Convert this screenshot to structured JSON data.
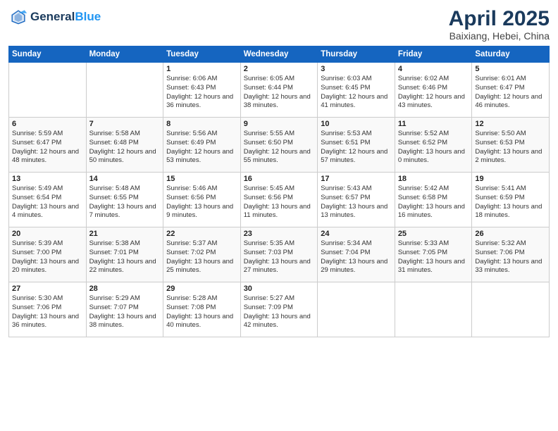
{
  "header": {
    "logo_line1": "General",
    "logo_line2": "Blue",
    "title": "April 2025",
    "subtitle": "Baixiang, Hebei, China"
  },
  "days_of_week": [
    "Sunday",
    "Monday",
    "Tuesday",
    "Wednesday",
    "Thursday",
    "Friday",
    "Saturday"
  ],
  "weeks": [
    [
      {
        "day": "",
        "sunrise": "",
        "sunset": "",
        "daylight": ""
      },
      {
        "day": "",
        "sunrise": "",
        "sunset": "",
        "daylight": ""
      },
      {
        "day": "1",
        "sunrise": "Sunrise: 6:06 AM",
        "sunset": "Sunset: 6:43 PM",
        "daylight": "Daylight: 12 hours and 36 minutes."
      },
      {
        "day": "2",
        "sunrise": "Sunrise: 6:05 AM",
        "sunset": "Sunset: 6:44 PM",
        "daylight": "Daylight: 12 hours and 38 minutes."
      },
      {
        "day": "3",
        "sunrise": "Sunrise: 6:03 AM",
        "sunset": "Sunset: 6:45 PM",
        "daylight": "Daylight: 12 hours and 41 minutes."
      },
      {
        "day": "4",
        "sunrise": "Sunrise: 6:02 AM",
        "sunset": "Sunset: 6:46 PM",
        "daylight": "Daylight: 12 hours and 43 minutes."
      },
      {
        "day": "5",
        "sunrise": "Sunrise: 6:01 AM",
        "sunset": "Sunset: 6:47 PM",
        "daylight": "Daylight: 12 hours and 46 minutes."
      }
    ],
    [
      {
        "day": "6",
        "sunrise": "Sunrise: 5:59 AM",
        "sunset": "Sunset: 6:47 PM",
        "daylight": "Daylight: 12 hours and 48 minutes."
      },
      {
        "day": "7",
        "sunrise": "Sunrise: 5:58 AM",
        "sunset": "Sunset: 6:48 PM",
        "daylight": "Daylight: 12 hours and 50 minutes."
      },
      {
        "day": "8",
        "sunrise": "Sunrise: 5:56 AM",
        "sunset": "Sunset: 6:49 PM",
        "daylight": "Daylight: 12 hours and 53 minutes."
      },
      {
        "day": "9",
        "sunrise": "Sunrise: 5:55 AM",
        "sunset": "Sunset: 6:50 PM",
        "daylight": "Daylight: 12 hours and 55 minutes."
      },
      {
        "day": "10",
        "sunrise": "Sunrise: 5:53 AM",
        "sunset": "Sunset: 6:51 PM",
        "daylight": "Daylight: 12 hours and 57 minutes."
      },
      {
        "day": "11",
        "sunrise": "Sunrise: 5:52 AM",
        "sunset": "Sunset: 6:52 PM",
        "daylight": "Daylight: 13 hours and 0 minutes."
      },
      {
        "day": "12",
        "sunrise": "Sunrise: 5:50 AM",
        "sunset": "Sunset: 6:53 PM",
        "daylight": "Daylight: 13 hours and 2 minutes."
      }
    ],
    [
      {
        "day": "13",
        "sunrise": "Sunrise: 5:49 AM",
        "sunset": "Sunset: 6:54 PM",
        "daylight": "Daylight: 13 hours and 4 minutes."
      },
      {
        "day": "14",
        "sunrise": "Sunrise: 5:48 AM",
        "sunset": "Sunset: 6:55 PM",
        "daylight": "Daylight: 13 hours and 7 minutes."
      },
      {
        "day": "15",
        "sunrise": "Sunrise: 5:46 AM",
        "sunset": "Sunset: 6:56 PM",
        "daylight": "Daylight: 13 hours and 9 minutes."
      },
      {
        "day": "16",
        "sunrise": "Sunrise: 5:45 AM",
        "sunset": "Sunset: 6:56 PM",
        "daylight": "Daylight: 13 hours and 11 minutes."
      },
      {
        "day": "17",
        "sunrise": "Sunrise: 5:43 AM",
        "sunset": "Sunset: 6:57 PM",
        "daylight": "Daylight: 13 hours and 13 minutes."
      },
      {
        "day": "18",
        "sunrise": "Sunrise: 5:42 AM",
        "sunset": "Sunset: 6:58 PM",
        "daylight": "Daylight: 13 hours and 16 minutes."
      },
      {
        "day": "19",
        "sunrise": "Sunrise: 5:41 AM",
        "sunset": "Sunset: 6:59 PM",
        "daylight": "Daylight: 13 hours and 18 minutes."
      }
    ],
    [
      {
        "day": "20",
        "sunrise": "Sunrise: 5:39 AM",
        "sunset": "Sunset: 7:00 PM",
        "daylight": "Daylight: 13 hours and 20 minutes."
      },
      {
        "day": "21",
        "sunrise": "Sunrise: 5:38 AM",
        "sunset": "Sunset: 7:01 PM",
        "daylight": "Daylight: 13 hours and 22 minutes."
      },
      {
        "day": "22",
        "sunrise": "Sunrise: 5:37 AM",
        "sunset": "Sunset: 7:02 PM",
        "daylight": "Daylight: 13 hours and 25 minutes."
      },
      {
        "day": "23",
        "sunrise": "Sunrise: 5:35 AM",
        "sunset": "Sunset: 7:03 PM",
        "daylight": "Daylight: 13 hours and 27 minutes."
      },
      {
        "day": "24",
        "sunrise": "Sunrise: 5:34 AM",
        "sunset": "Sunset: 7:04 PM",
        "daylight": "Daylight: 13 hours and 29 minutes."
      },
      {
        "day": "25",
        "sunrise": "Sunrise: 5:33 AM",
        "sunset": "Sunset: 7:05 PM",
        "daylight": "Daylight: 13 hours and 31 minutes."
      },
      {
        "day": "26",
        "sunrise": "Sunrise: 5:32 AM",
        "sunset": "Sunset: 7:06 PM",
        "daylight": "Daylight: 13 hours and 33 minutes."
      }
    ],
    [
      {
        "day": "27",
        "sunrise": "Sunrise: 5:30 AM",
        "sunset": "Sunset: 7:06 PM",
        "daylight": "Daylight: 13 hours and 36 minutes."
      },
      {
        "day": "28",
        "sunrise": "Sunrise: 5:29 AM",
        "sunset": "Sunset: 7:07 PM",
        "daylight": "Daylight: 13 hours and 38 minutes."
      },
      {
        "day": "29",
        "sunrise": "Sunrise: 5:28 AM",
        "sunset": "Sunset: 7:08 PM",
        "daylight": "Daylight: 13 hours and 40 minutes."
      },
      {
        "day": "30",
        "sunrise": "Sunrise: 5:27 AM",
        "sunset": "Sunset: 7:09 PM",
        "daylight": "Daylight: 13 hours and 42 minutes."
      },
      {
        "day": "",
        "sunrise": "",
        "sunset": "",
        "daylight": ""
      },
      {
        "day": "",
        "sunrise": "",
        "sunset": "",
        "daylight": ""
      },
      {
        "day": "",
        "sunrise": "",
        "sunset": "",
        "daylight": ""
      }
    ]
  ]
}
